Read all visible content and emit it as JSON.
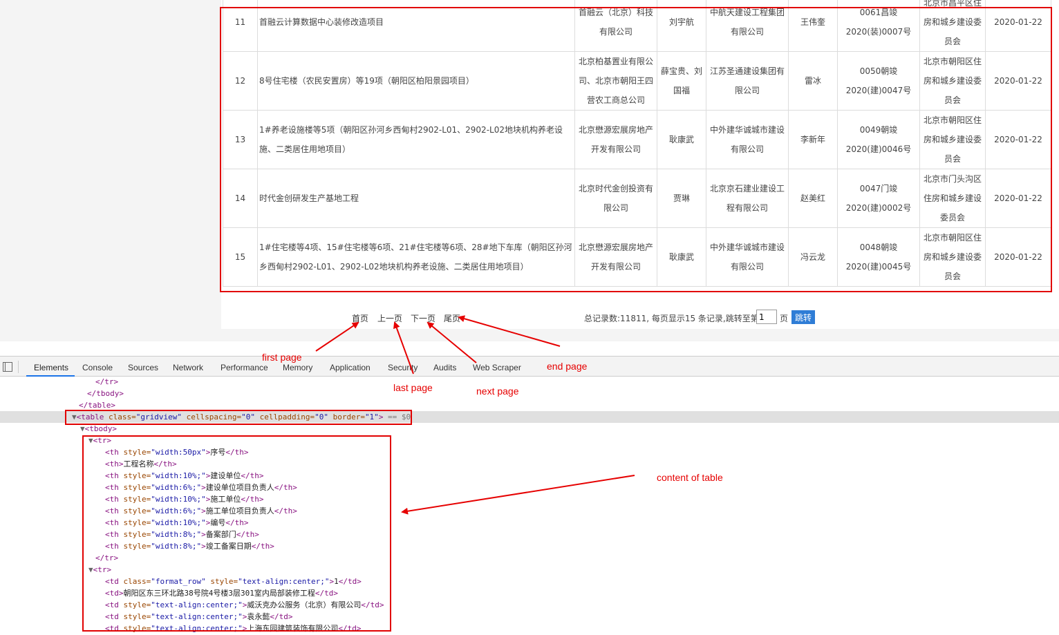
{
  "table": {
    "rows": [
      {
        "no": "11",
        "name": "首融云计算数据中心装修改造项目",
        "builder": "首融云（北京）科技有限公司",
        "builder_lead": "刘宇航",
        "contractor": "中航天建设工程集团有限公司",
        "contractor_lead": "王伟奎",
        "code": "0061昌竣2020(装)0007号",
        "dept": "北京市昌平区住房和城乡建设委员会",
        "date": "2020-01-22"
      },
      {
        "no": "12",
        "name": "8号住宅楼（农民安置房）等19项（朝阳区柏阳景园项目）",
        "builder": "北京柏基置业有限公司、北京市朝阳王四营农工商总公司",
        "builder_lead": "薛宝贵、刘国福",
        "contractor": "江苏圣通建设集团有限公司",
        "contractor_lead": "雷冰",
        "code": "0050朝竣2020(建)0047号",
        "dept": "北京市朝阳区住房和城乡建设委员会",
        "date": "2020-01-22"
      },
      {
        "no": "13",
        "name": "1#养老设施楼等5项（朝阳区孙河乡西甸村2902-L01、2902-L02地块机构养老设施、二类居住用地项目）",
        "builder": "北京懋源宏展房地产开发有限公司",
        "builder_lead": "耿康武",
        "contractor": "中外建华诚城市建设有限公司",
        "contractor_lead": "李新年",
        "code": "0049朝竣2020(建)0046号",
        "dept": "北京市朝阳区住房和城乡建设委员会",
        "date": "2020-01-22"
      },
      {
        "no": "14",
        "name": "时代金创研发生产基地工程",
        "builder": "北京时代金创投资有限公司",
        "builder_lead": "贾琳",
        "contractor": "北京京石建业建设工程有限公司",
        "contractor_lead": "赵美红",
        "code": "0047门竣2020(建)0002号",
        "dept": "北京市门头沟区住房和城乡建设委员会",
        "date": "2020-01-22"
      },
      {
        "no": "15",
        "name": "1#住宅楼等4项、15#住宅楼等6项、21#住宅楼等6项、28#地下车库（朝阳区孙河乡西甸村2902-L01、2902-L02地块机构养老设施、二类居住用地项目）",
        "builder": "北京懋源宏展房地产开发有限公司",
        "builder_lead": "耿康武",
        "contractor": "中外建华诚城市建设有限公司",
        "contractor_lead": "冯云龙",
        "code": "0048朝竣2020(建)0045号",
        "dept": "北京市朝阳区住房和城乡建设委员会",
        "date": "2020-01-22"
      }
    ]
  },
  "pager": {
    "first": "首页",
    "prev": "上一页",
    "next": "下一页",
    "last": "尾页",
    "summary": "总记录数:11811, 每页显示15 条记录,跳转至第",
    "page_value": "1",
    "unit": "页",
    "jump_label": "跳转"
  },
  "devtools": {
    "tabs": [
      "Elements",
      "Console",
      "Sources",
      "Network",
      "Performance",
      "Memory",
      "Application",
      "Security",
      "Audits",
      "Web Scraper"
    ],
    "active_tab": "Elements"
  },
  "code": {
    "close_tr": "</tr>",
    "close_tbody": "</tbody>",
    "close_table": "</table>",
    "table_open_tag": "<table",
    "table_attr_class": "class=",
    "table_val_class": "\"gridview\"",
    "table_attr_cellspacing": "cellspacing=",
    "table_val_cellspacing": "\"0\"",
    "table_attr_cellpadding": "cellpadding=",
    "table_val_cellpadding": "\"0\"",
    "table_attr_border": "border=",
    "table_val_border": "\"1\"",
    "table_end": ">",
    "selected_marker": " == $0",
    "tbody_open": "<tbody>",
    "tr_open": "<tr>",
    "th_lines": [
      {
        "style": "width:50px",
        "text": "序号"
      },
      {
        "style": "",
        "text": "工程名称"
      },
      {
        "style": "width:10%;",
        "text": "建设单位"
      },
      {
        "style": "width:6%;",
        "text": "建设单位项目负责人"
      },
      {
        "style": "width:10%;",
        "text": "施工单位"
      },
      {
        "style": "width:6%;",
        "text": "施工单位项目负责人"
      },
      {
        "style": "width:10%;",
        "text": "编号"
      },
      {
        "style": "width:8%;",
        "text": "备案部门"
      },
      {
        "style": "width:8%;",
        "text": "竣工备案日期"
      }
    ],
    "td_lines": [
      {
        "cls": "format_row",
        "style": "text-align:center;",
        "text": "1"
      },
      {
        "cls": "",
        "style": "",
        "text": "朝阳区东三环北路38号院4号楼3层301室内局部装修工程"
      },
      {
        "cls": "",
        "style": "text-align:center;",
        "text": "威沃克办公服务（北京）有限公司"
      },
      {
        "cls": "",
        "style": "text-align:center;",
        "text": "袁永懿"
      },
      {
        "cls": "",
        "style": "text-align:center;",
        "text": "上海东园建筑装饰有限公司"
      }
    ]
  },
  "annotations": {
    "first_page": "first page",
    "last_page": "last page",
    "next_page": "next page",
    "end_page": "end page",
    "content_of_table": "content of table"
  }
}
